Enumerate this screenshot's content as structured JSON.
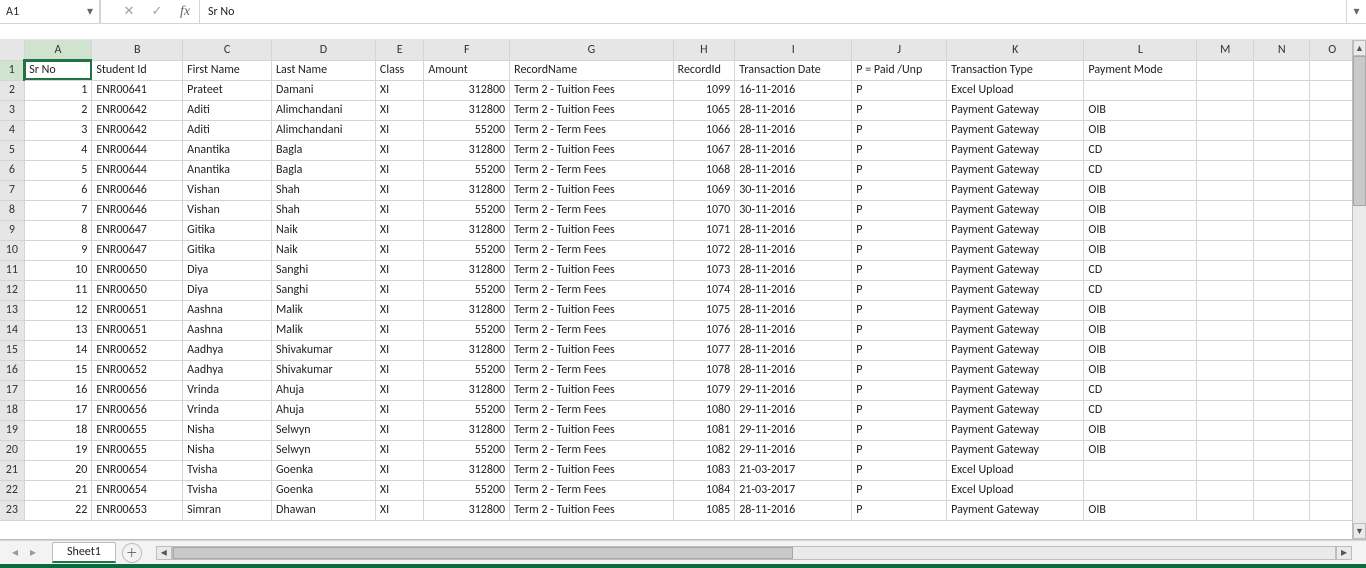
{
  "formula_bar": {
    "cell_ref": "A1",
    "cancel": "✕",
    "confirm": "✓",
    "fx": "fx",
    "value": "Sr No"
  },
  "columns": [
    "A",
    "B",
    "C",
    "D",
    "E",
    "F",
    "G",
    "H",
    "I",
    "J",
    "K",
    "L",
    "M",
    "N",
    "O"
  ],
  "headers": {
    "SrNo": "Sr No",
    "StudentId": "Student Id",
    "FirstName": "First Name",
    "LastName": "Last Name",
    "Class": "Class",
    "Amount": "Amount",
    "RecordName": "RecordName",
    "RecordId": "RecordId",
    "TransactionDate": "Transaction Date",
    "Paid": "P = Paid /Unp",
    "TransactionType": "Transaction Type",
    "PaymentMode": "Payment Mode"
  },
  "sheets": {
    "active": "Sheet1"
  },
  "rows": [
    {
      "n": 1,
      "SrNo": "1",
      "StudentId": "ENR00641",
      "FirstName": "Prateet",
      "LastName": "Damani",
      "Class": "XI",
      "Amount": "312800",
      "RecordName": "Term 2 - Tuition Fees",
      "RecordId": "1099",
      "TransactionDate": "16-11-2016",
      "Paid": "P",
      "TransactionType": "Excel Upload",
      "PaymentMode": ""
    },
    {
      "n": 2,
      "SrNo": "2",
      "StudentId": "ENR00642",
      "FirstName": "Aditi",
      "LastName": "Alimchandani",
      "Class": "XI",
      "Amount": "312800",
      "RecordName": "Term 2 - Tuition Fees",
      "RecordId": "1065",
      "TransactionDate": "28-11-2016",
      "Paid": "P",
      "TransactionType": "Payment Gateway",
      "PaymentMode": "OIB"
    },
    {
      "n": 3,
      "SrNo": "3",
      "StudentId": "ENR00642",
      "FirstName": "Aditi",
      "LastName": "Alimchandani",
      "Class": "XI",
      "Amount": "55200",
      "RecordName": "Term 2 - Term Fees",
      "RecordId": "1066",
      "TransactionDate": "28-11-2016",
      "Paid": "P",
      "TransactionType": "Payment Gateway",
      "PaymentMode": "OIB"
    },
    {
      "n": 4,
      "SrNo": "4",
      "StudentId": "ENR00644",
      "FirstName": "Anantika",
      "LastName": "Bagla",
      "Class": "XI",
      "Amount": "312800",
      "RecordName": "Term 2 - Tuition Fees",
      "RecordId": "1067",
      "TransactionDate": "28-11-2016",
      "Paid": "P",
      "TransactionType": "Payment Gateway",
      "PaymentMode": "CD"
    },
    {
      "n": 5,
      "SrNo": "5",
      "StudentId": "ENR00644",
      "FirstName": "Anantika",
      "LastName": "Bagla",
      "Class": "XI",
      "Amount": "55200",
      "RecordName": "Term 2 - Term Fees",
      "RecordId": "1068",
      "TransactionDate": "28-11-2016",
      "Paid": "P",
      "TransactionType": "Payment Gateway",
      "PaymentMode": "CD"
    },
    {
      "n": 6,
      "SrNo": "6",
      "StudentId": "ENR00646",
      "FirstName": "Vishan",
      "LastName": "Shah",
      "Class": "XI",
      "Amount": "312800",
      "RecordName": "Term 2 - Tuition Fees",
      "RecordId": "1069",
      "TransactionDate": "30-11-2016",
      "Paid": "P",
      "TransactionType": "Payment Gateway",
      "PaymentMode": "OIB"
    },
    {
      "n": 7,
      "SrNo": "7",
      "StudentId": "ENR00646",
      "FirstName": "Vishan",
      "LastName": "Shah",
      "Class": "XI",
      "Amount": "55200",
      "RecordName": "Term 2 - Term Fees",
      "RecordId": "1070",
      "TransactionDate": "30-11-2016",
      "Paid": "P",
      "TransactionType": "Payment Gateway",
      "PaymentMode": "OIB"
    },
    {
      "n": 8,
      "SrNo": "8",
      "StudentId": "ENR00647",
      "FirstName": "Gitika",
      "LastName": "Naik",
      "Class": "XI",
      "Amount": "312800",
      "RecordName": "Term 2 - Tuition Fees",
      "RecordId": "1071",
      "TransactionDate": "28-11-2016",
      "Paid": "P",
      "TransactionType": "Payment Gateway",
      "PaymentMode": "OIB"
    },
    {
      "n": 9,
      "SrNo": "9",
      "StudentId": "ENR00647",
      "FirstName": "Gitika",
      "LastName": "Naik",
      "Class": "XI",
      "Amount": "55200",
      "RecordName": "Term 2 - Term Fees",
      "RecordId": "1072",
      "TransactionDate": "28-11-2016",
      "Paid": "P",
      "TransactionType": "Payment Gateway",
      "PaymentMode": "OIB"
    },
    {
      "n": 10,
      "SrNo": "10",
      "StudentId": "ENR00650",
      "FirstName": "Diya",
      "LastName": "Sanghi",
      "Class": "XI",
      "Amount": "312800",
      "RecordName": "Term 2 - Tuition Fees",
      "RecordId": "1073",
      "TransactionDate": "28-11-2016",
      "Paid": "P",
      "TransactionType": "Payment Gateway",
      "PaymentMode": "CD"
    },
    {
      "n": 11,
      "SrNo": "11",
      "StudentId": "ENR00650",
      "FirstName": "Diya",
      "LastName": "Sanghi",
      "Class": "XI",
      "Amount": "55200",
      "RecordName": "Term 2 - Term Fees",
      "RecordId": "1074",
      "TransactionDate": "28-11-2016",
      "Paid": "P",
      "TransactionType": "Payment Gateway",
      "PaymentMode": "CD"
    },
    {
      "n": 12,
      "SrNo": "12",
      "StudentId": "ENR00651",
      "FirstName": "Aashna",
      "LastName": "Malik",
      "Class": "XI",
      "Amount": "312800",
      "RecordName": "Term 2 - Tuition Fees",
      "RecordId": "1075",
      "TransactionDate": "28-11-2016",
      "Paid": "P",
      "TransactionType": "Payment Gateway",
      "PaymentMode": "OIB"
    },
    {
      "n": 13,
      "SrNo": "13",
      "StudentId": "ENR00651",
      "FirstName": "Aashna",
      "LastName": "Malik",
      "Class": "XI",
      "Amount": "55200",
      "RecordName": "Term 2 - Term Fees",
      "RecordId": "1076",
      "TransactionDate": "28-11-2016",
      "Paid": "P",
      "TransactionType": "Payment Gateway",
      "PaymentMode": "OIB"
    },
    {
      "n": 14,
      "SrNo": "14",
      "StudentId": "ENR00652",
      "FirstName": "Aadhya",
      "LastName": "Shivakumar",
      "Class": "XI",
      "Amount": "312800",
      "RecordName": "Term 2 - Tuition Fees",
      "RecordId": "1077",
      "TransactionDate": "28-11-2016",
      "Paid": "P",
      "TransactionType": "Payment Gateway",
      "PaymentMode": "OIB"
    },
    {
      "n": 15,
      "SrNo": "15",
      "StudentId": "ENR00652",
      "FirstName": "Aadhya",
      "LastName": "Shivakumar",
      "Class": "XI",
      "Amount": "55200",
      "RecordName": "Term 2 - Term Fees",
      "RecordId": "1078",
      "TransactionDate": "28-11-2016",
      "Paid": "P",
      "TransactionType": "Payment Gateway",
      "PaymentMode": "OIB"
    },
    {
      "n": 16,
      "SrNo": "16",
      "StudentId": "ENR00656",
      "FirstName": "Vrinda",
      "LastName": "Ahuja",
      "Class": "XI",
      "Amount": "312800",
      "RecordName": "Term 2 - Tuition Fees",
      "RecordId": "1079",
      "TransactionDate": "29-11-2016",
      "Paid": "P",
      "TransactionType": "Payment Gateway",
      "PaymentMode": "CD"
    },
    {
      "n": 17,
      "SrNo": "17",
      "StudentId": "ENR00656",
      "FirstName": "Vrinda",
      "LastName": "Ahuja",
      "Class": "XI",
      "Amount": "55200",
      "RecordName": "Term 2 - Term Fees",
      "RecordId": "1080",
      "TransactionDate": "29-11-2016",
      "Paid": "P",
      "TransactionType": "Payment Gateway",
      "PaymentMode": "CD"
    },
    {
      "n": 18,
      "SrNo": "18",
      "StudentId": "ENR00655",
      "FirstName": "Nisha",
      "LastName": "Selwyn",
      "Class": "XI",
      "Amount": "312800",
      "RecordName": "Term 2 - Tuition Fees",
      "RecordId": "1081",
      "TransactionDate": "29-11-2016",
      "Paid": "P",
      "TransactionType": "Payment Gateway",
      "PaymentMode": "OIB"
    },
    {
      "n": 19,
      "SrNo": "19",
      "StudentId": "ENR00655",
      "FirstName": "Nisha",
      "LastName": "Selwyn",
      "Class": "XI",
      "Amount": "55200",
      "RecordName": "Term 2 - Term Fees",
      "RecordId": "1082",
      "TransactionDate": "29-11-2016",
      "Paid": "P",
      "TransactionType": "Payment Gateway",
      "PaymentMode": "OIB"
    },
    {
      "n": 20,
      "SrNo": "20",
      "StudentId": "ENR00654",
      "FirstName": "Tvisha",
      "LastName": "Goenka",
      "Class": "XI",
      "Amount": "312800",
      "RecordName": "Term 2 - Tuition Fees",
      "RecordId": "1083",
      "TransactionDate": "21-03-2017",
      "Paid": "P",
      "TransactionType": "Excel Upload",
      "PaymentMode": ""
    },
    {
      "n": 21,
      "SrNo": "21",
      "StudentId": "ENR00654",
      "FirstName": "Tvisha",
      "LastName": "Goenka",
      "Class": "XI",
      "Amount": "55200",
      "RecordName": "Term 2 - Term Fees",
      "RecordId": "1084",
      "TransactionDate": "21-03-2017",
      "Paid": "P",
      "TransactionType": "Excel Upload",
      "PaymentMode": ""
    },
    {
      "n": 22,
      "SrNo": "22",
      "StudentId": "ENR00653",
      "FirstName": "Simran",
      "LastName": "Dhawan",
      "Class": "XI",
      "Amount": "312800",
      "RecordName": "Term 2 - Tuition Fees",
      "RecordId": "1085",
      "TransactionDate": "28-11-2016",
      "Paid": "P",
      "TransactionType": "Payment Gateway",
      "PaymentMode": "OIB"
    }
  ]
}
